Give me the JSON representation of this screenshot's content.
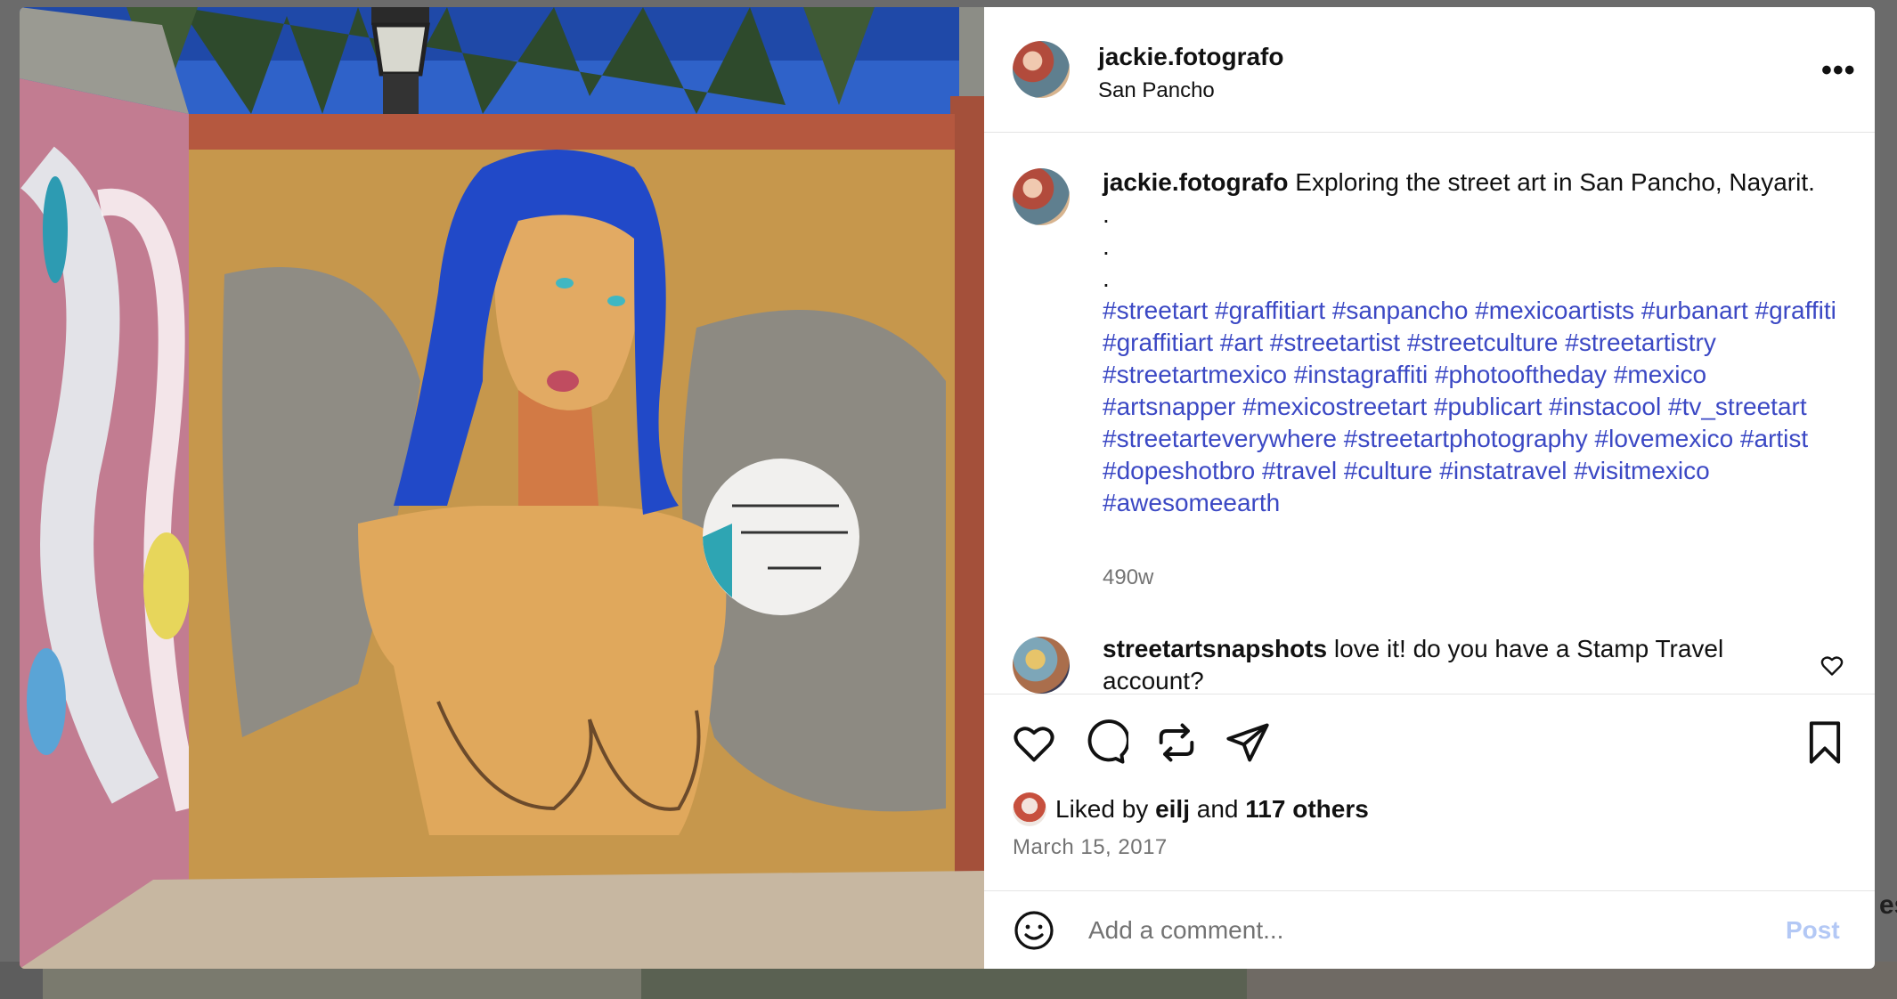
{
  "post": {
    "username": "jackie.fotografo",
    "location": "San Pancho",
    "more_icon": "more-horizontal-icon"
  },
  "caption": {
    "username": "jackie.fotografo",
    "text": "Exploring the street art in San Pancho, Nayarit.",
    "dots": [
      ".",
      ".",
      "."
    ],
    "hashtags": "#streetart #graffitiart #sanpancho #mexicoartists #urbanart #graffiti #graffitiart #art #streetartist #streetculture #streetartistry #streetartmexico #instagraffiti #photooftheday #mexico #artsnapper #mexicostreetart #publicart #instacool #tv_streetart #streetarteverywhere #streetartphotography #lovemexico #artist #dopeshotbro #travel #culture #instatravel #visitmexico #awesomeearth",
    "time": "490w"
  },
  "comments": [
    {
      "username": "streetartsnapshots",
      "text": "love it! do you have a Stamp Travel account?"
    }
  ],
  "actions": {
    "icons": [
      "heart-icon",
      "comment-icon",
      "repost-icon",
      "share-icon",
      "bookmark-icon"
    ]
  },
  "likes": {
    "prefix": "Liked by",
    "user": "eilj",
    "connector": "and",
    "others": "117 others"
  },
  "date": "March 15, 2017",
  "add_comment": {
    "placeholder": "Add a comment...",
    "post_label": "Post"
  },
  "background": {
    "side_text": "es"
  },
  "colors": {
    "hashtag": "#3b48c4",
    "post_button": "#b3c8f5",
    "muted": "#737373"
  }
}
